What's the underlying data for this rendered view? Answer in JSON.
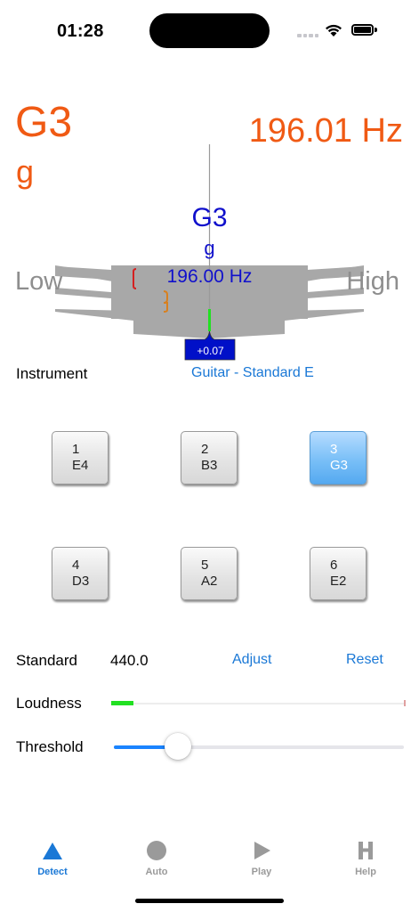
{
  "status_bar": {
    "time": "01:28"
  },
  "detected": {
    "note": "G3",
    "solfege": "g",
    "frequency": "196.01 Hz"
  },
  "target": {
    "note": "G3",
    "solfege": "g",
    "frequency": "196.00 Hz",
    "cents": "+0.07"
  },
  "meter": {
    "low_label": "Low",
    "high_label": "High"
  },
  "instrument": {
    "label": "Instrument",
    "value": "Guitar - Standard E"
  },
  "strings": [
    {
      "number": "1",
      "note": "E4",
      "active": false
    },
    {
      "number": "2",
      "note": "B3",
      "active": false
    },
    {
      "number": "3",
      "note": "G3",
      "active": true
    },
    {
      "number": "4",
      "note": "D3",
      "active": false
    },
    {
      "number": "5",
      "note": "A2",
      "active": false
    },
    {
      "number": "6",
      "note": "E2",
      "active": false
    }
  ],
  "standard": {
    "label": "Standard",
    "value": "440.0",
    "adjust_label": "Adjust",
    "reset_label": "Reset"
  },
  "loudness": {
    "label": "Loudness",
    "level": 0.08
  },
  "threshold": {
    "label": "Threshold",
    "value": 0.22
  },
  "tabs": [
    {
      "label": "Detect",
      "icon": "triangle-icon",
      "active": true
    },
    {
      "label": "Auto",
      "icon": "circle-icon",
      "active": false
    },
    {
      "label": "Play",
      "icon": "play-icon",
      "active": false
    },
    {
      "label": "Help",
      "icon": "h-letter-icon",
      "active": false
    }
  ],
  "colors": {
    "accent": "#1a78d6",
    "detected": "#f05a14",
    "target": "#1010cc",
    "in_tune": "#22e022",
    "active_button": "#79bff7"
  }
}
